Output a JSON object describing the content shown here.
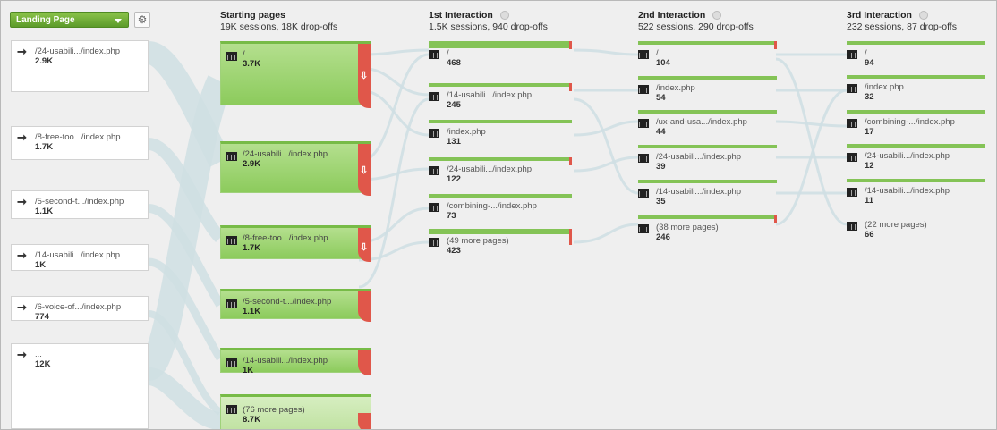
{
  "header": {
    "selector_label": "Landing Page",
    "columns": [
      {
        "title": "Starting pages",
        "sub": "19K sessions, 18K drop-offs"
      },
      {
        "title": "1st Interaction",
        "sub": "1.5K sessions, 940 drop-offs"
      },
      {
        "title": "2nd Interaction",
        "sub": "522 sessions, 290 drop-offs"
      },
      {
        "title": "3rd Interaction",
        "sub": "232 sessions, 87 drop-offs"
      }
    ]
  },
  "landing_pages": [
    {
      "name": "/24-usabili.../index.php",
      "count": "2.9K"
    },
    {
      "name": "/8-free-too.../index.php",
      "count": "1.7K"
    },
    {
      "name": "/5-second-t.../index.php",
      "count": "1.1K"
    },
    {
      "name": "/14-usabili.../index.php",
      "count": "1K"
    },
    {
      "name": "/6-voice-of.../index.php",
      "count": "774"
    },
    {
      "name": "...",
      "count": "12K"
    }
  ],
  "starting_pages": [
    {
      "name": "/",
      "count": "3.7K"
    },
    {
      "name": "/24-usabili.../index.php",
      "count": "2.9K"
    },
    {
      "name": "/8-free-too.../index.php",
      "count": "1.7K"
    },
    {
      "name": "/5-second-t.../index.php",
      "count": "1.1K"
    },
    {
      "name": "/14-usabili.../index.php",
      "count": "1K"
    },
    {
      "name": "(76 more pages)",
      "count": "8.7K"
    }
  ],
  "first_interaction": [
    {
      "name": "/",
      "count": "468"
    },
    {
      "name": "/14-usabili.../index.php",
      "count": "245"
    },
    {
      "name": "/index.php",
      "count": "131"
    },
    {
      "name": "/24-usabili.../index.php",
      "count": "122"
    },
    {
      "name": "/combining-.../index.php",
      "count": "73"
    },
    {
      "name": "(49 more pages)",
      "count": "423"
    }
  ],
  "second_interaction": [
    {
      "name": "/",
      "count": "104"
    },
    {
      "name": "/index.php",
      "count": "54"
    },
    {
      "name": "/ux-and-usa.../index.php",
      "count": "44"
    },
    {
      "name": "/24-usabili.../index.php",
      "count": "39"
    },
    {
      "name": "/14-usabili.../index.php",
      "count": "35"
    },
    {
      "name": "(38 more pages)",
      "count": "246"
    }
  ],
  "third_interaction": [
    {
      "name": "/",
      "count": "94"
    },
    {
      "name": "/index.php",
      "count": "32"
    },
    {
      "name": "/combining-.../index.php",
      "count": "17"
    },
    {
      "name": "/24-usabili.../index.php",
      "count": "12"
    },
    {
      "name": "/14-usabili.../index.php",
      "count": "11"
    },
    {
      "name": "(22 more pages)",
      "count": "66"
    }
  ],
  "colors": {
    "node_green": "#8ccb5c",
    "drop_red": "#e0574a",
    "flow": "#cfdfe3"
  }
}
